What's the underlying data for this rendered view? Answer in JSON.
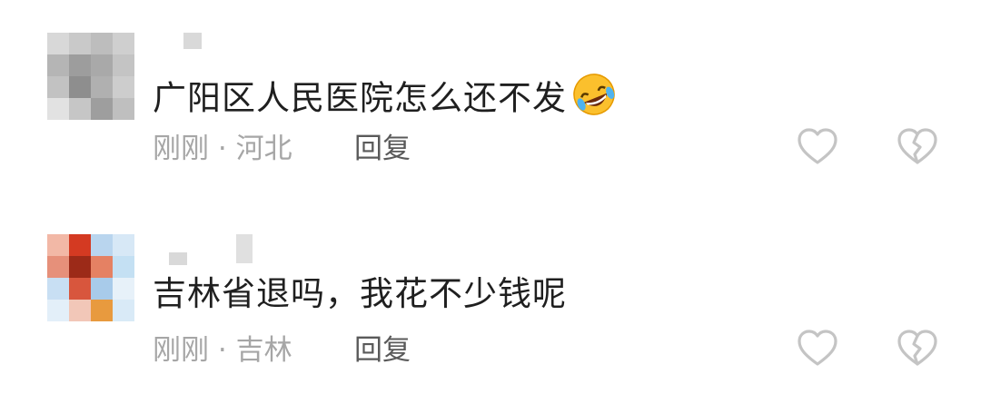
{
  "comments": [
    {
      "text": "广阳区人民医院怎么还不发",
      "emoji": "rolling-on-floor-laughing-emoji",
      "time": "刚刚",
      "separator": "·",
      "location": "河北",
      "reply_label": "回复",
      "avatar_colors": [
        "#d8d8d8",
        "#c9c9c9",
        "#bdbdbd",
        "#cfcfcf",
        "#b5b5b5",
        "#9d9d9d",
        "#a9a9a9",
        "#c4c4c4",
        "#c2c2c2",
        "#8e8e8e",
        "#b0b0b0",
        "#cdcdcd",
        "#e2e2e2",
        "#c6c6c6",
        "#9e9e9e",
        "#bfbfbf"
      ]
    },
    {
      "text": "吉林省退吗，我花不少钱呢",
      "time": "刚刚",
      "separator": "·",
      "location": "吉林",
      "reply_label": "回复",
      "avatar_colors": [
        "#f2b8a6",
        "#d43a22",
        "#b9d5ee",
        "#d7e8f6",
        "#e6907a",
        "#9c2a18",
        "#e58163",
        "#c4e0f3",
        "#c8dff3",
        "#d8563d",
        "#a8cbea",
        "#e7f1f9",
        "#e3eff9",
        "#f2c7b8",
        "#e89a3e",
        "#d9eaf7"
      ]
    }
  ],
  "colors": {
    "text": "#1f1f1f",
    "meta": "#a6a6a6",
    "reply": "#5a5a5a",
    "icon": "#c4c4c4"
  },
  "icons": {
    "like": "heart-outline-icon",
    "dislike": "broken-heart-outline-icon"
  }
}
